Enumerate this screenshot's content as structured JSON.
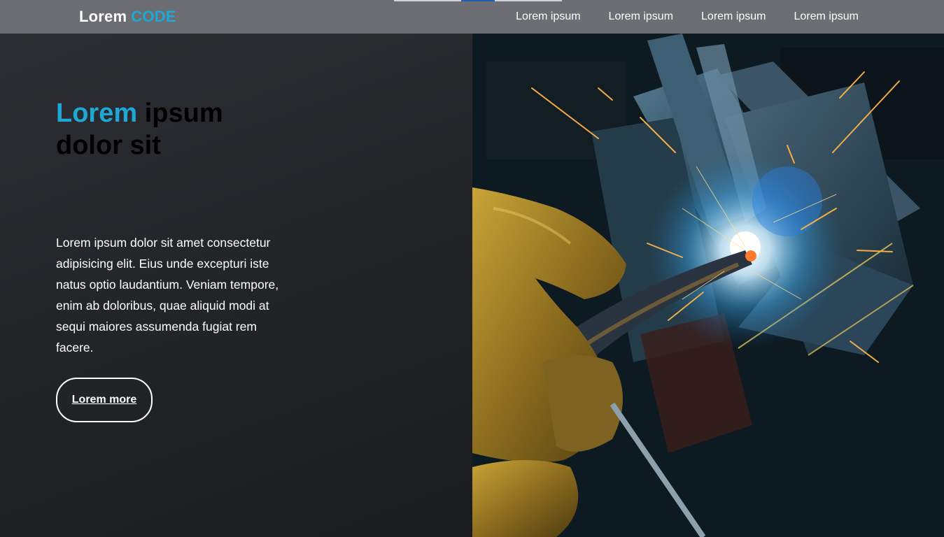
{
  "header": {
    "logo_main": "Lorem",
    "logo_accent": "CODE",
    "nav": [
      {
        "label": "Lorem ipsum"
      },
      {
        "label": "Lorem ipsum"
      },
      {
        "label": "Lorem ipsum"
      },
      {
        "label": "Lorem ipsum"
      }
    ]
  },
  "hero": {
    "headline_accent": "Lorem",
    "headline_rest_1": "ipsum",
    "headline_rest_2": "dolor sit",
    "paragraph": "Lorem ipsum dolor sit amet consectetur adipisicing elit. Eius unde excepturi iste natus optio laudantium. Veniam tempore, enim ab doloribus, quae aliquid modi at sequi maiores assumenda fugiat rem facere.",
    "button_label": "Lorem more",
    "image_icon": "welding-photo"
  },
  "colors": {
    "accent": "#1ea8d6",
    "header_bg": "#6c6e73",
    "panel_bg": "#232529",
    "headline_text": "#000000"
  }
}
